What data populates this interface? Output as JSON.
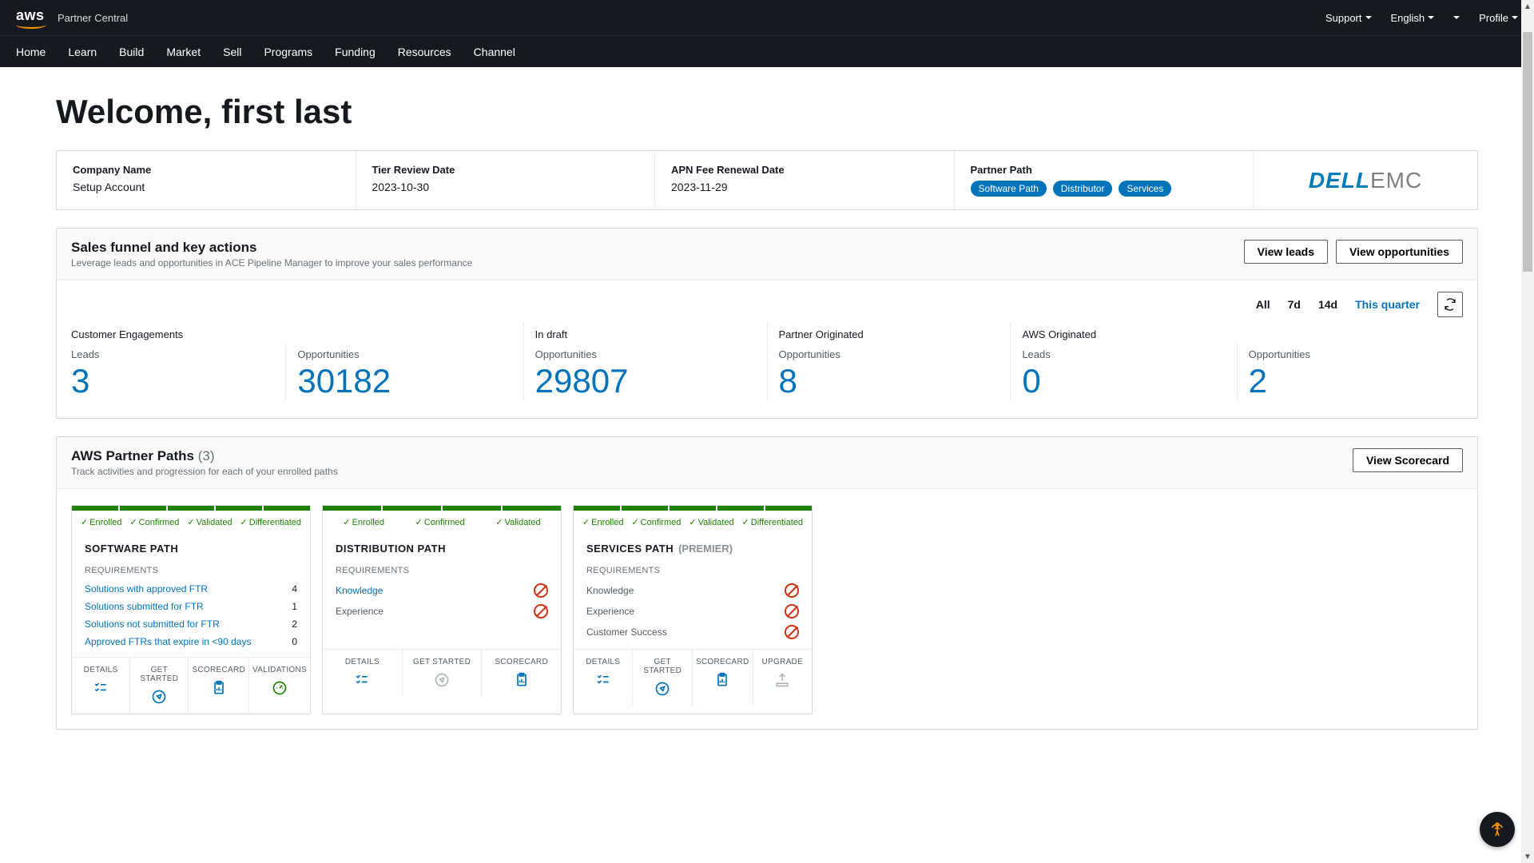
{
  "header": {
    "brand": "aws",
    "brand_sub": "Partner Central",
    "support": "Support",
    "language": "English",
    "profile": "Profile",
    "nav": [
      "Home",
      "Learn",
      "Build",
      "Market",
      "Sell",
      "Programs",
      "Funding",
      "Resources",
      "Channel"
    ]
  },
  "welcome": "Welcome, first last",
  "info": {
    "company_label": "Company Name",
    "company_value": "Setup Account",
    "tier_label": "Tier Review Date",
    "tier_value": "2023-10-30",
    "fee_label": "APN Fee Renewal Date",
    "fee_value": "2023-11-29",
    "path_label": "Partner Path",
    "badges": [
      "Software Path",
      "Distributor",
      "Services"
    ],
    "partner_logo_a": "DELL",
    "partner_logo_b": "EMC"
  },
  "funnel": {
    "title": "Sales funnel and key actions",
    "sub": "Leverage leads and opportunities in ACE Pipeline Manager to improve your sales performance",
    "btn_leads": "View leads",
    "btn_opps": "View opportunities",
    "filters": {
      "all": "All",
      "d7": "7d",
      "d14": "14d",
      "quarter": "This quarter"
    },
    "groups": {
      "customer": "Customer Engagements",
      "draft": "In draft",
      "partner": "Partner Originated",
      "aws": "AWS Originated"
    },
    "sub_leads": "Leads",
    "sub_opps": "Opportunities",
    "values": {
      "cust_leads": "3",
      "cust_opps": "30182",
      "draft_opps": "29807",
      "partner_opps": "8",
      "aws_leads": "0",
      "aws_opps": "2"
    }
  },
  "paths": {
    "title": "AWS Partner Paths",
    "count": "(3)",
    "sub": "Track activities and progression for each of your enrolled paths",
    "btn": "View Scorecard",
    "stages5": [
      "Enrolled",
      "Confirmed",
      "Validated",
      "Differentiated"
    ],
    "stages4": [
      "Enrolled",
      "Confirmed",
      "Validated"
    ],
    "req_label": "REQUIREMENTS",
    "pf": {
      "details": "DETAILS",
      "start": "GET STARTED",
      "score": "SCORECARD",
      "valid": "VALIDATIONS",
      "upgrade": "UPGRADE"
    },
    "card1": {
      "title": "SOFTWARE PATH",
      "rows": [
        {
          "label": "Solutions with approved FTR",
          "val": "4"
        },
        {
          "label": "Solutions submitted for FTR",
          "val": "1"
        },
        {
          "label": "Solutions not submitted for FTR",
          "val": "2"
        },
        {
          "label": "Approved FTRs that expire in <90 days",
          "val": "0"
        }
      ]
    },
    "card2": {
      "title": "DISTRIBUTION PATH",
      "rows": [
        {
          "label": "Knowledge"
        },
        {
          "label": "Experience"
        }
      ]
    },
    "card3": {
      "title": "SERVICES PATH",
      "tier": "(PREMIER)",
      "rows": [
        {
          "label": "Knowledge"
        },
        {
          "label": "Experience"
        },
        {
          "label": "Customer Success"
        }
      ]
    }
  }
}
